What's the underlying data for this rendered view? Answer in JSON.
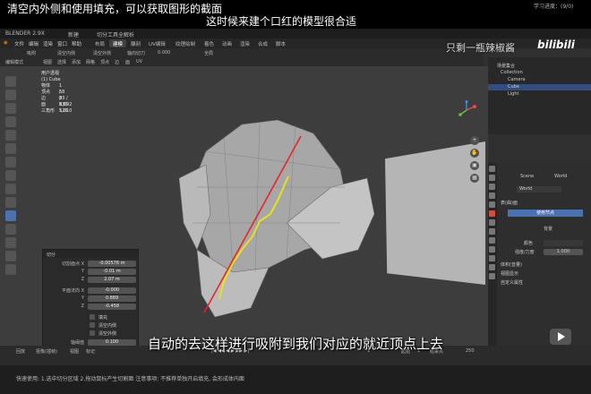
{
  "captions": {
    "top_line1": "清空内外侧和使用填充，可以获取图形的截面",
    "top_line2": "这时候来建个口红的模型很合适",
    "subtitle": "自动的去这样进行吸附到我们对应的就近顶点上去",
    "watermark": "只剩一瓶辣椒酱",
    "logo": "bilibili"
  },
  "titlebar": {
    "app": "BLENDER 2.9X",
    "tab": "新建",
    "doc": "切分工具全解析"
  },
  "menu": [
    "文件",
    "编辑",
    "渲染",
    "窗口",
    "帮助"
  ],
  "workspaces": [
    "布局",
    "建模",
    "雕刻",
    "UV编辑",
    "纹理绘制",
    "着色",
    "动画",
    "渲染",
    "合成",
    "脚本"
  ],
  "active_workspace": "建模",
  "toolsettings": [
    "吸附",
    "清空内侧",
    "清空外侧",
    "轴向切刀",
    "0.000",
    "全局"
  ],
  "header3d": [
    "编辑模式",
    "视图",
    "选择",
    "添加",
    "网格",
    "顶点",
    "边",
    "面",
    "UV"
  ],
  "viewport_info": {
    "view": "用户透视",
    "object": "(1) Cube",
    "rows": [
      {
        "label": "物体",
        "value": "1 / 3"
      },
      {
        "label": "顶点",
        "value": "58 / 530"
      },
      {
        "label": "边",
        "value": "93 / 1,092"
      },
      {
        "label": "面",
        "value": "0 / 526"
      },
      {
        "label": "三角形",
        "value": "1,010"
      }
    ]
  },
  "operator": {
    "title": "切分",
    "plane_point_label": "切割面点 X",
    "fields": [
      {
        "label": "切割面点 X",
        "value": "-0.00576 m"
      },
      {
        "label": "Y",
        "value": "-0.01 m"
      },
      {
        "label": "Z",
        "value": "2.07 m"
      },
      {
        "label": "平面法向 X",
        "value": "-0.000"
      },
      {
        "label": "Y",
        "value": "0.889"
      },
      {
        "label": "Z",
        "value": "-0.458"
      }
    ],
    "checks": [
      "填充",
      "清空内侧",
      "清空外侧"
    ],
    "threshold_label": "轴阈值",
    "threshold": "0.100"
  },
  "outliner": {
    "title": "场景集合",
    "items": [
      "Collection",
      "Camera",
      "Cube",
      "Light"
    ],
    "selected": "Cube"
  },
  "properties": {
    "scene": "Scene",
    "world": "World",
    "world_name": "World",
    "section_surface": "表(曲)面",
    "use_nodes": "使用节点",
    "background": "背景",
    "color_label": "颜色",
    "strength_label": "强度/力度",
    "strength": "1.000",
    "volume": "体积(音量)",
    "viewport_display": "视图显示",
    "custom_props": "自定义属性"
  },
  "timeline": {
    "playback": "回放",
    "keying": "抠像(插帧)",
    "view": "视图",
    "markers": "标记",
    "start_label": "起始",
    "start": "1",
    "end_label": "结束点",
    "end": "250",
    "current": "1"
  },
  "status": "快速使用: 1.选中切分区域  2.拖动鼠标产生切割面    注意事项: 不推荐单独开启填充, 会形成体内面",
  "progress_label": "学习进度：",
  "progress": "(9/0)",
  "colors": {
    "cut_line": "#e8242a",
    "section_line": "#e8e11c",
    "accent": "#4a72b0"
  }
}
